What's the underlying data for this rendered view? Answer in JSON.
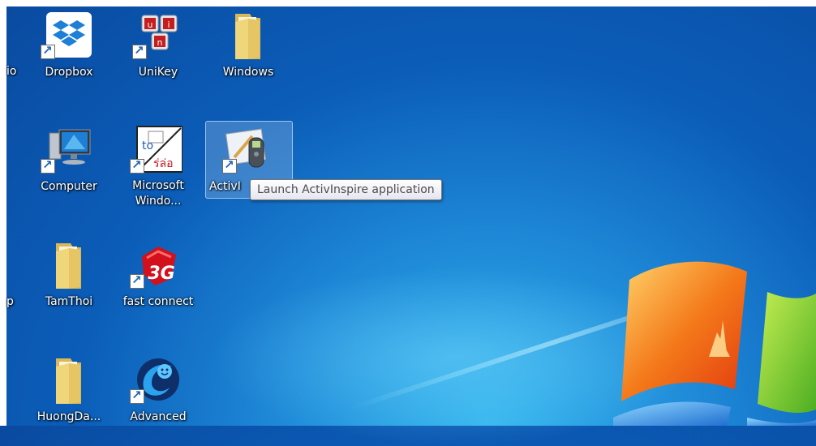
{
  "desktop": {
    "icons": [
      {
        "label": "Dropbox",
        "icon": "dropbox-icon"
      },
      {
        "label": "UniKey",
        "icon": "unikey-icon"
      },
      {
        "label": "Windows",
        "icon": "folder-icon"
      },
      {
        "label": "Computer",
        "icon": "computer-icon"
      },
      {
        "label": "Microsoft Windo...",
        "icon": "microsoft-windows-app-icon"
      },
      {
        "label": "ActivI",
        "icon": "activinspire-icon"
      },
      {
        "label": "TamThoi",
        "icon": "folder-icon"
      },
      {
        "label": "fast connect",
        "icon": "fast-connect-icon"
      },
      {
        "label": "HuongDa...",
        "icon": "folder-icon"
      },
      {
        "label": "Advanced",
        "icon": "advanced-icon"
      }
    ],
    "cut_labels": [
      "io",
      "p"
    ]
  },
  "tooltip": {
    "text": "Launch ActivInspire application"
  },
  "colors": {
    "wallpaper": "#0b5db8",
    "label_text": "#ffffff",
    "selection": "#96bee6"
  }
}
